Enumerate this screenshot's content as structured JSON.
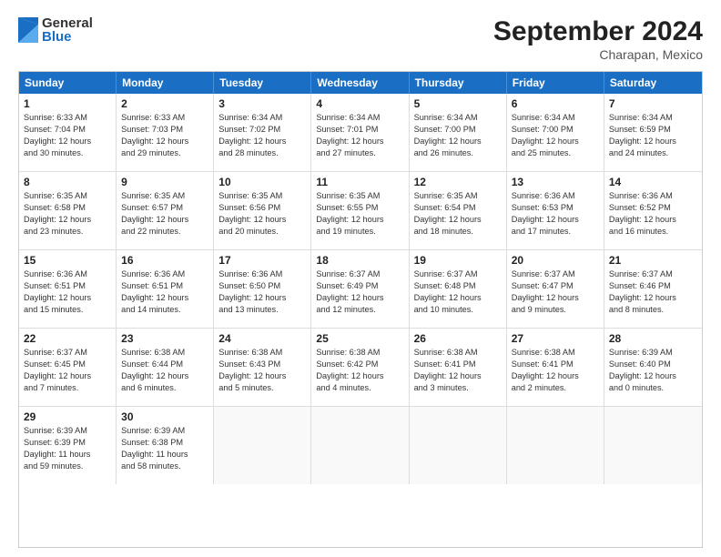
{
  "logo": {
    "general": "General",
    "blue": "Blue"
  },
  "title": "September 2024",
  "subtitle": "Charapan, Mexico",
  "days": [
    "Sunday",
    "Monday",
    "Tuesday",
    "Wednesday",
    "Thursday",
    "Friday",
    "Saturday"
  ],
  "rows": [
    [
      {
        "day": "1",
        "line1": "Sunrise: 6:33 AM",
        "line2": "Sunset: 7:04 PM",
        "line3": "Daylight: 12 hours",
        "line4": "and 30 minutes."
      },
      {
        "day": "2",
        "line1": "Sunrise: 6:33 AM",
        "line2": "Sunset: 7:03 PM",
        "line3": "Daylight: 12 hours",
        "line4": "and 29 minutes."
      },
      {
        "day": "3",
        "line1": "Sunrise: 6:34 AM",
        "line2": "Sunset: 7:02 PM",
        "line3": "Daylight: 12 hours",
        "line4": "and 28 minutes."
      },
      {
        "day": "4",
        "line1": "Sunrise: 6:34 AM",
        "line2": "Sunset: 7:01 PM",
        "line3": "Daylight: 12 hours",
        "line4": "and 27 minutes."
      },
      {
        "day": "5",
        "line1": "Sunrise: 6:34 AM",
        "line2": "Sunset: 7:00 PM",
        "line3": "Daylight: 12 hours",
        "line4": "and 26 minutes."
      },
      {
        "day": "6",
        "line1": "Sunrise: 6:34 AM",
        "line2": "Sunset: 7:00 PM",
        "line3": "Daylight: 12 hours",
        "line4": "and 25 minutes."
      },
      {
        "day": "7",
        "line1": "Sunrise: 6:34 AM",
        "line2": "Sunset: 6:59 PM",
        "line3": "Daylight: 12 hours",
        "line4": "and 24 minutes."
      }
    ],
    [
      {
        "day": "8",
        "line1": "Sunrise: 6:35 AM",
        "line2": "Sunset: 6:58 PM",
        "line3": "Daylight: 12 hours",
        "line4": "and 23 minutes."
      },
      {
        "day": "9",
        "line1": "Sunrise: 6:35 AM",
        "line2": "Sunset: 6:57 PM",
        "line3": "Daylight: 12 hours",
        "line4": "and 22 minutes."
      },
      {
        "day": "10",
        "line1": "Sunrise: 6:35 AM",
        "line2": "Sunset: 6:56 PM",
        "line3": "Daylight: 12 hours",
        "line4": "and 20 minutes."
      },
      {
        "day": "11",
        "line1": "Sunrise: 6:35 AM",
        "line2": "Sunset: 6:55 PM",
        "line3": "Daylight: 12 hours",
        "line4": "and 19 minutes."
      },
      {
        "day": "12",
        "line1": "Sunrise: 6:35 AM",
        "line2": "Sunset: 6:54 PM",
        "line3": "Daylight: 12 hours",
        "line4": "and 18 minutes."
      },
      {
        "day": "13",
        "line1": "Sunrise: 6:36 AM",
        "line2": "Sunset: 6:53 PM",
        "line3": "Daylight: 12 hours",
        "line4": "and 17 minutes."
      },
      {
        "day": "14",
        "line1": "Sunrise: 6:36 AM",
        "line2": "Sunset: 6:52 PM",
        "line3": "Daylight: 12 hours",
        "line4": "and 16 minutes."
      }
    ],
    [
      {
        "day": "15",
        "line1": "Sunrise: 6:36 AM",
        "line2": "Sunset: 6:51 PM",
        "line3": "Daylight: 12 hours",
        "line4": "and 15 minutes."
      },
      {
        "day": "16",
        "line1": "Sunrise: 6:36 AM",
        "line2": "Sunset: 6:51 PM",
        "line3": "Daylight: 12 hours",
        "line4": "and 14 minutes."
      },
      {
        "day": "17",
        "line1": "Sunrise: 6:36 AM",
        "line2": "Sunset: 6:50 PM",
        "line3": "Daylight: 12 hours",
        "line4": "and 13 minutes."
      },
      {
        "day": "18",
        "line1": "Sunrise: 6:37 AM",
        "line2": "Sunset: 6:49 PM",
        "line3": "Daylight: 12 hours",
        "line4": "and 12 minutes."
      },
      {
        "day": "19",
        "line1": "Sunrise: 6:37 AM",
        "line2": "Sunset: 6:48 PM",
        "line3": "Daylight: 12 hours",
        "line4": "and 10 minutes."
      },
      {
        "day": "20",
        "line1": "Sunrise: 6:37 AM",
        "line2": "Sunset: 6:47 PM",
        "line3": "Daylight: 12 hours",
        "line4": "and 9 minutes."
      },
      {
        "day": "21",
        "line1": "Sunrise: 6:37 AM",
        "line2": "Sunset: 6:46 PM",
        "line3": "Daylight: 12 hours",
        "line4": "and 8 minutes."
      }
    ],
    [
      {
        "day": "22",
        "line1": "Sunrise: 6:37 AM",
        "line2": "Sunset: 6:45 PM",
        "line3": "Daylight: 12 hours",
        "line4": "and 7 minutes."
      },
      {
        "day": "23",
        "line1": "Sunrise: 6:38 AM",
        "line2": "Sunset: 6:44 PM",
        "line3": "Daylight: 12 hours",
        "line4": "and 6 minutes."
      },
      {
        "day": "24",
        "line1": "Sunrise: 6:38 AM",
        "line2": "Sunset: 6:43 PM",
        "line3": "Daylight: 12 hours",
        "line4": "and 5 minutes."
      },
      {
        "day": "25",
        "line1": "Sunrise: 6:38 AM",
        "line2": "Sunset: 6:42 PM",
        "line3": "Daylight: 12 hours",
        "line4": "and 4 minutes."
      },
      {
        "day": "26",
        "line1": "Sunrise: 6:38 AM",
        "line2": "Sunset: 6:41 PM",
        "line3": "Daylight: 12 hours",
        "line4": "and 3 minutes."
      },
      {
        "day": "27",
        "line1": "Sunrise: 6:38 AM",
        "line2": "Sunset: 6:41 PM",
        "line3": "Daylight: 12 hours",
        "line4": "and 2 minutes."
      },
      {
        "day": "28",
        "line1": "Sunrise: 6:39 AM",
        "line2": "Sunset: 6:40 PM",
        "line3": "Daylight: 12 hours",
        "line4": "and 0 minutes."
      }
    ],
    [
      {
        "day": "29",
        "line1": "Sunrise: 6:39 AM",
        "line2": "Sunset: 6:39 PM",
        "line3": "Daylight: 11 hours",
        "line4": "and 59 minutes."
      },
      {
        "day": "30",
        "line1": "Sunrise: 6:39 AM",
        "line2": "Sunset: 6:38 PM",
        "line3": "Daylight: 11 hours",
        "line4": "and 58 minutes."
      },
      {
        "day": "",
        "line1": "",
        "line2": "",
        "line3": "",
        "line4": ""
      },
      {
        "day": "",
        "line1": "",
        "line2": "",
        "line3": "",
        "line4": ""
      },
      {
        "day": "",
        "line1": "",
        "line2": "",
        "line3": "",
        "line4": ""
      },
      {
        "day": "",
        "line1": "",
        "line2": "",
        "line3": "",
        "line4": ""
      },
      {
        "day": "",
        "line1": "",
        "line2": "",
        "line3": "",
        "line4": ""
      }
    ]
  ]
}
